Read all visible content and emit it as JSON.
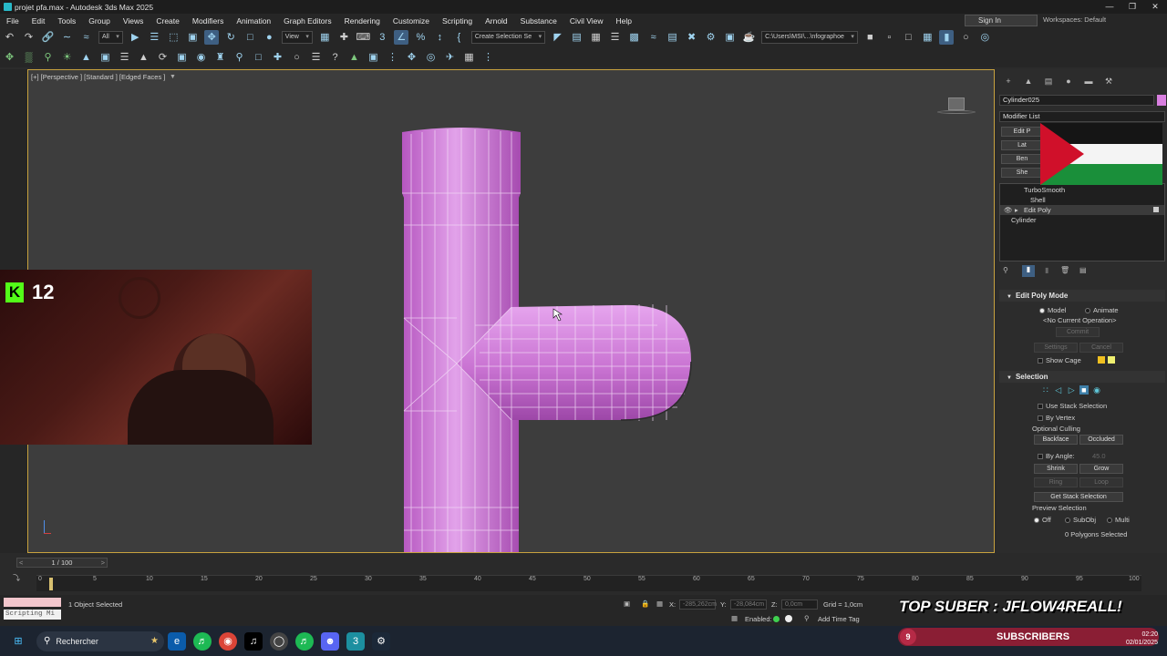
{
  "window": {
    "title": "projet pfa.max - Autodesk 3ds Max 2025"
  },
  "menu": [
    "File",
    "Edit",
    "Tools",
    "Group",
    "Views",
    "Create",
    "Modifiers",
    "Animation",
    "Graph Editors",
    "Rendering",
    "Customize",
    "Scripting",
    "Arnold",
    "Substance",
    "Civil View",
    "Help"
  ],
  "account": {
    "sign_in": "Sign In",
    "workspace": "Workspaces: Default"
  },
  "toolbar": {
    "filter_value": "All",
    "view_value": "View",
    "selection_set_placeholder": "Create Selection Se",
    "project_path": "C:\\Users\\MSI\\...\\nfographoe"
  },
  "viewport": {
    "label": "[+] [Perspective ] [Standard ] [Edged Faces ]"
  },
  "command_panel": {
    "object_name": "Cylinder025",
    "object_color": "#d97fe0",
    "modifier_list_label": "Modifier List",
    "preset_buttons": [
      "Edit P",
      "Lat",
      "Ben",
      "She"
    ],
    "stack": [
      "TurboSmooth",
      "Shell",
      "Edit Poly",
      "Cylinder"
    ],
    "edit_poly_mode": {
      "title": "Edit Poly Mode",
      "model": "Model",
      "animate": "Animate",
      "operation": "<No Current Operation>",
      "commit": "Commit",
      "settings": "Settings",
      "cancel": "Cancel",
      "show_cage": "Show Cage"
    },
    "selection": {
      "title": "Selection",
      "use_stack": "Use Stack Selection",
      "by_vertex": "By Vertex",
      "optional_culling": "Optional Culling",
      "backface": "Backface",
      "occluded": "Occluded",
      "by_angle": "By Angle:",
      "angle_value": "45.0",
      "shrink": "Shrink",
      "grow": "Grow",
      "ring": "Ring",
      "loop": "Loop",
      "get_stack": "Get Stack Selection",
      "preview_selection": "Preview Selection",
      "preview_options": [
        "Off",
        "SubObj",
        "Multi"
      ],
      "status": "0 Polygons Selected"
    }
  },
  "timeline": {
    "frame_display": "1 / 100",
    "ticks": [
      "0",
      "5",
      "10",
      "15",
      "20",
      "25",
      "30",
      "35",
      "40",
      "45",
      "50",
      "55",
      "60",
      "65",
      "70",
      "75",
      "80",
      "85",
      "90",
      "95",
      "100"
    ]
  },
  "statusbar": {
    "script_label": "Scripting Mi",
    "selection": "1 Object Selected",
    "x_label": "X:",
    "x_value": "-285,262cm",
    "y_label": "Y:",
    "y_value": "-28,084cm",
    "z_label": "Z:",
    "z_value": "0,0cm",
    "grid": "Grid = 1,0cm",
    "enabled": "Enabled:",
    "add_time_tag": "Add Time Tag"
  },
  "taskbar": {
    "search": "Rechercher",
    "time": "02:20",
    "date": "02/01/2025"
  },
  "overlays": {
    "kick_count": "12",
    "top_suber": "TOP SUBER : JFLOW4REALL!",
    "subscribers_count": "9",
    "subscribers_label": "SUBSCRIBERS"
  }
}
